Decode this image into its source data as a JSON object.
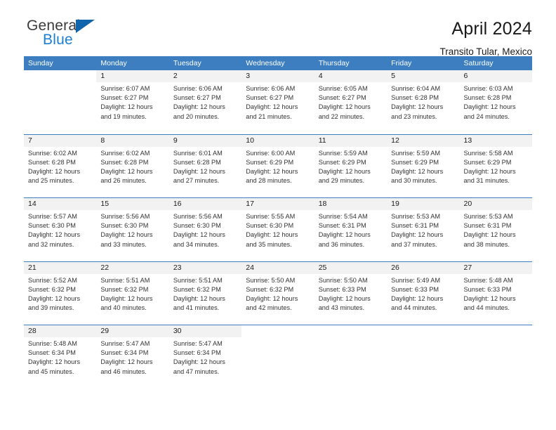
{
  "brand": {
    "name_top": "General",
    "name_bottom": "Blue",
    "triangle_icon": "triangle-logo-icon",
    "color_top": "#3b3b3b",
    "color_bottom": "#1b7fd4",
    "triangle_color": "#1064ab"
  },
  "header": {
    "month_title": "April 2024",
    "location": "Transito Tular, Mexico"
  },
  "theme": {
    "header_band": "#3c7ebf",
    "day_band": "#f2f2f2",
    "row_divider": "#3c7ebf",
    "text": "#333333"
  },
  "weekdays": [
    "Sunday",
    "Monday",
    "Tuesday",
    "Wednesday",
    "Thursday",
    "Friday",
    "Saturday"
  ],
  "weeks": [
    [
      {
        "day": "",
        "sunrise": "",
        "sunset": "",
        "daylight_line1": "",
        "daylight_line2": ""
      },
      {
        "day": "1",
        "sunrise": "Sunrise: 6:07 AM",
        "sunset": "Sunset: 6:27 PM",
        "daylight_line1": "Daylight: 12 hours",
        "daylight_line2": "and 19 minutes."
      },
      {
        "day": "2",
        "sunrise": "Sunrise: 6:06 AM",
        "sunset": "Sunset: 6:27 PM",
        "daylight_line1": "Daylight: 12 hours",
        "daylight_line2": "and 20 minutes."
      },
      {
        "day": "3",
        "sunrise": "Sunrise: 6:06 AM",
        "sunset": "Sunset: 6:27 PM",
        "daylight_line1": "Daylight: 12 hours",
        "daylight_line2": "and 21 minutes."
      },
      {
        "day": "4",
        "sunrise": "Sunrise: 6:05 AM",
        "sunset": "Sunset: 6:27 PM",
        "daylight_line1": "Daylight: 12 hours",
        "daylight_line2": "and 22 minutes."
      },
      {
        "day": "5",
        "sunrise": "Sunrise: 6:04 AM",
        "sunset": "Sunset: 6:28 PM",
        "daylight_line1": "Daylight: 12 hours",
        "daylight_line2": "and 23 minutes."
      },
      {
        "day": "6",
        "sunrise": "Sunrise: 6:03 AM",
        "sunset": "Sunset: 6:28 PM",
        "daylight_line1": "Daylight: 12 hours",
        "daylight_line2": "and 24 minutes."
      }
    ],
    [
      {
        "day": "7",
        "sunrise": "Sunrise: 6:02 AM",
        "sunset": "Sunset: 6:28 PM",
        "daylight_line1": "Daylight: 12 hours",
        "daylight_line2": "and 25 minutes."
      },
      {
        "day": "8",
        "sunrise": "Sunrise: 6:02 AM",
        "sunset": "Sunset: 6:28 PM",
        "daylight_line1": "Daylight: 12 hours",
        "daylight_line2": "and 26 minutes."
      },
      {
        "day": "9",
        "sunrise": "Sunrise: 6:01 AM",
        "sunset": "Sunset: 6:28 PM",
        "daylight_line1": "Daylight: 12 hours",
        "daylight_line2": "and 27 minutes."
      },
      {
        "day": "10",
        "sunrise": "Sunrise: 6:00 AM",
        "sunset": "Sunset: 6:29 PM",
        "daylight_line1": "Daylight: 12 hours",
        "daylight_line2": "and 28 minutes."
      },
      {
        "day": "11",
        "sunrise": "Sunrise: 5:59 AM",
        "sunset": "Sunset: 6:29 PM",
        "daylight_line1": "Daylight: 12 hours",
        "daylight_line2": "and 29 minutes."
      },
      {
        "day": "12",
        "sunrise": "Sunrise: 5:59 AM",
        "sunset": "Sunset: 6:29 PM",
        "daylight_line1": "Daylight: 12 hours",
        "daylight_line2": "and 30 minutes."
      },
      {
        "day": "13",
        "sunrise": "Sunrise: 5:58 AM",
        "sunset": "Sunset: 6:29 PM",
        "daylight_line1": "Daylight: 12 hours",
        "daylight_line2": "and 31 minutes."
      }
    ],
    [
      {
        "day": "14",
        "sunrise": "Sunrise: 5:57 AM",
        "sunset": "Sunset: 6:30 PM",
        "daylight_line1": "Daylight: 12 hours",
        "daylight_line2": "and 32 minutes."
      },
      {
        "day": "15",
        "sunrise": "Sunrise: 5:56 AM",
        "sunset": "Sunset: 6:30 PM",
        "daylight_line1": "Daylight: 12 hours",
        "daylight_line2": "and 33 minutes."
      },
      {
        "day": "16",
        "sunrise": "Sunrise: 5:56 AM",
        "sunset": "Sunset: 6:30 PM",
        "daylight_line1": "Daylight: 12 hours",
        "daylight_line2": "and 34 minutes."
      },
      {
        "day": "17",
        "sunrise": "Sunrise: 5:55 AM",
        "sunset": "Sunset: 6:30 PM",
        "daylight_line1": "Daylight: 12 hours",
        "daylight_line2": "and 35 minutes."
      },
      {
        "day": "18",
        "sunrise": "Sunrise: 5:54 AM",
        "sunset": "Sunset: 6:31 PM",
        "daylight_line1": "Daylight: 12 hours",
        "daylight_line2": "and 36 minutes."
      },
      {
        "day": "19",
        "sunrise": "Sunrise: 5:53 AM",
        "sunset": "Sunset: 6:31 PM",
        "daylight_line1": "Daylight: 12 hours",
        "daylight_line2": "and 37 minutes."
      },
      {
        "day": "20",
        "sunrise": "Sunrise: 5:53 AM",
        "sunset": "Sunset: 6:31 PM",
        "daylight_line1": "Daylight: 12 hours",
        "daylight_line2": "and 38 minutes."
      }
    ],
    [
      {
        "day": "21",
        "sunrise": "Sunrise: 5:52 AM",
        "sunset": "Sunset: 6:32 PM",
        "daylight_line1": "Daylight: 12 hours",
        "daylight_line2": "and 39 minutes."
      },
      {
        "day": "22",
        "sunrise": "Sunrise: 5:51 AM",
        "sunset": "Sunset: 6:32 PM",
        "daylight_line1": "Daylight: 12 hours",
        "daylight_line2": "and 40 minutes."
      },
      {
        "day": "23",
        "sunrise": "Sunrise: 5:51 AM",
        "sunset": "Sunset: 6:32 PM",
        "daylight_line1": "Daylight: 12 hours",
        "daylight_line2": "and 41 minutes."
      },
      {
        "day": "24",
        "sunrise": "Sunrise: 5:50 AM",
        "sunset": "Sunset: 6:32 PM",
        "daylight_line1": "Daylight: 12 hours",
        "daylight_line2": "and 42 minutes."
      },
      {
        "day": "25",
        "sunrise": "Sunrise: 5:50 AM",
        "sunset": "Sunset: 6:33 PM",
        "daylight_line1": "Daylight: 12 hours",
        "daylight_line2": "and 43 minutes."
      },
      {
        "day": "26",
        "sunrise": "Sunrise: 5:49 AM",
        "sunset": "Sunset: 6:33 PM",
        "daylight_line1": "Daylight: 12 hours",
        "daylight_line2": "and 44 minutes."
      },
      {
        "day": "27",
        "sunrise": "Sunrise: 5:48 AM",
        "sunset": "Sunset: 6:33 PM",
        "daylight_line1": "Daylight: 12 hours",
        "daylight_line2": "and 44 minutes."
      }
    ],
    [
      {
        "day": "28",
        "sunrise": "Sunrise: 5:48 AM",
        "sunset": "Sunset: 6:34 PM",
        "daylight_line1": "Daylight: 12 hours",
        "daylight_line2": "and 45 minutes."
      },
      {
        "day": "29",
        "sunrise": "Sunrise: 5:47 AM",
        "sunset": "Sunset: 6:34 PM",
        "daylight_line1": "Daylight: 12 hours",
        "daylight_line2": "and 46 minutes."
      },
      {
        "day": "30",
        "sunrise": "Sunrise: 5:47 AM",
        "sunset": "Sunset: 6:34 PM",
        "daylight_line1": "Daylight: 12 hours",
        "daylight_line2": "and 47 minutes."
      },
      {
        "day": "",
        "sunrise": "",
        "sunset": "",
        "daylight_line1": "",
        "daylight_line2": ""
      },
      {
        "day": "",
        "sunrise": "",
        "sunset": "",
        "daylight_line1": "",
        "daylight_line2": ""
      },
      {
        "day": "",
        "sunrise": "",
        "sunset": "",
        "daylight_line1": "",
        "daylight_line2": ""
      },
      {
        "day": "",
        "sunrise": "",
        "sunset": "",
        "daylight_line1": "",
        "daylight_line2": ""
      }
    ]
  ]
}
